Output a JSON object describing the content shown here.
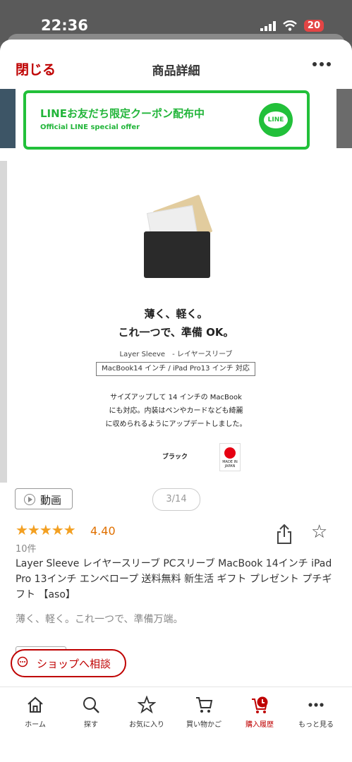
{
  "status_bar": {
    "time": "22:36",
    "battery": "20"
  },
  "header": {
    "close_label": "閉じる",
    "title": "商品詳細"
  },
  "banner": {
    "main_text": "LINEお友だち限定クーポン配布中",
    "sub_text": "Official LINE special offer",
    "logo_text": "LINE"
  },
  "product_image": {
    "headline1": "薄く、軽く。",
    "headline2": "これ一つで、準備 OK。",
    "name_line": "Layer Sleeve　- レイヤースリーブ",
    "compat": "MacBook14 インチ / iPad Pro13 インチ 対応",
    "desc_lines": [
      "サイズアップして 14 インチの MacBook",
      "にも対応。内装はペンやカードなども綺麗",
      "に収められるようにアップデートしました。"
    ],
    "color_label": "ブラック",
    "made_in": "MADE IN JAPAN"
  },
  "media": {
    "video_label": "動画",
    "pager": "3/14"
  },
  "rating": {
    "stars": "★★★★★",
    "value": 4.4,
    "value_text": "4.40",
    "reviews": "10件"
  },
  "product": {
    "title": "Layer Sleeve レイヤースリーブ PCスリーブ MacBook 14インチ iPad Pro 13インチ エンベロープ 送料無料 新生活 ギフト プレゼント プチギフト 【aso】",
    "catch": "薄く、軽く。これ一つで、準備万端。"
  },
  "consult_label": "ショップへ相談",
  "tabs": [
    {
      "label": "ホーム",
      "icon": "home-icon"
    },
    {
      "label": "探す",
      "icon": "search-icon"
    },
    {
      "label": "お気に入り",
      "icon": "star-icon"
    },
    {
      "label": "買い物かご",
      "icon": "cart-icon"
    },
    {
      "label": "購入履歴",
      "icon": "purchase-history-icon",
      "active": true
    },
    {
      "label": "もっと見る",
      "icon": "more-icon"
    }
  ],
  "colors": {
    "brand": "#bf0000",
    "line_green": "#22c03a",
    "star": "#f3a022"
  }
}
